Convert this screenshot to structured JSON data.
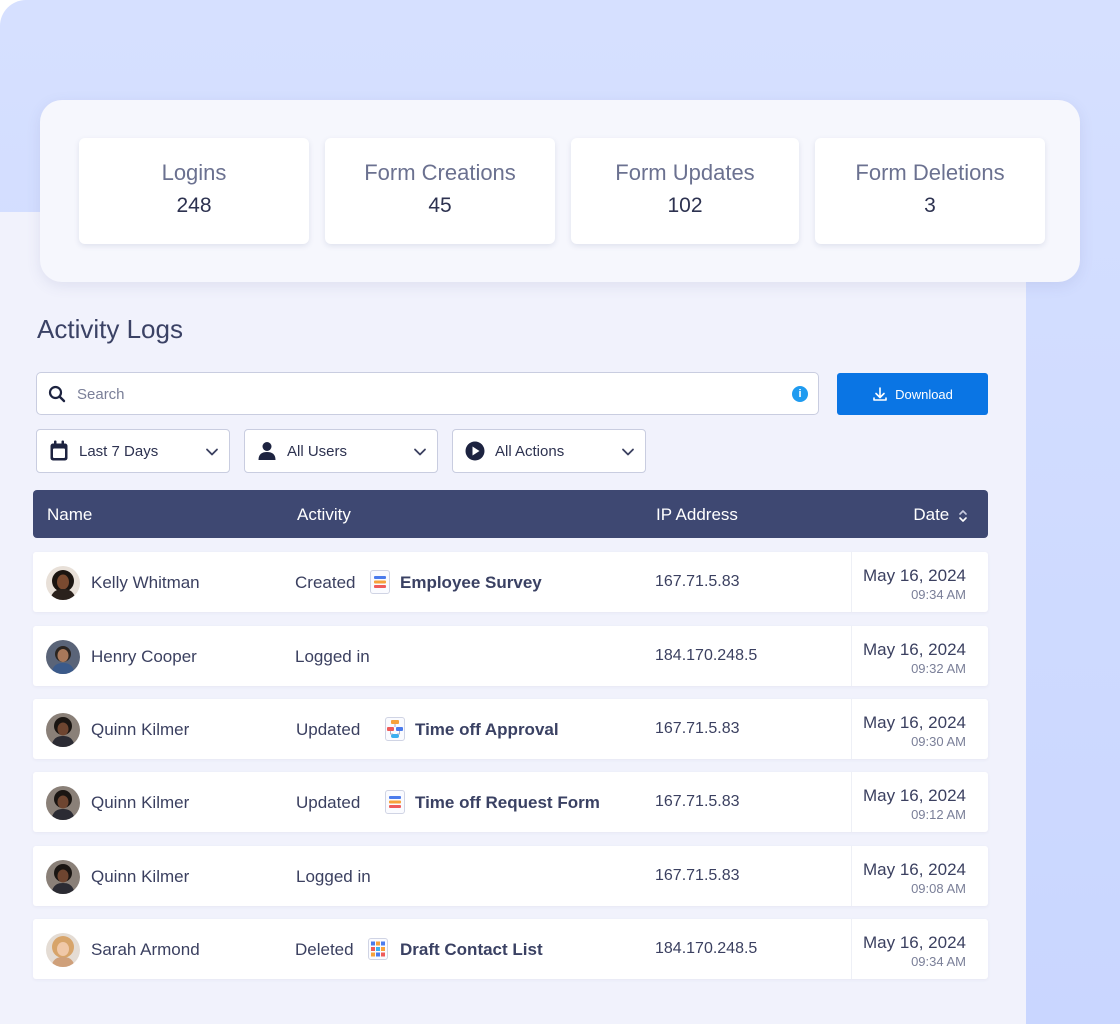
{
  "stats": [
    {
      "label": "Logins",
      "value": "248"
    },
    {
      "label": "Form Creations",
      "value": "45"
    },
    {
      "label": "Form Updates",
      "value": "102"
    },
    {
      "label": "Form Deletions",
      "value": "3"
    }
  ],
  "page_title": "Activity Logs",
  "search": {
    "placeholder": "Search",
    "value": ""
  },
  "download_label": "Download",
  "filters": {
    "date": "Last 7 Days",
    "users": "All Users",
    "actions": "All Actions"
  },
  "table": {
    "headers": {
      "name": "Name",
      "activity": "Activity",
      "ip": "IP Address",
      "date": "Date"
    },
    "rows": [
      {
        "name": "Kelly Whitman",
        "action": "Created",
        "form": "Employee Survey",
        "ip": "167.71.5.83",
        "date": "May 16, 2024",
        "time": "09:34 AM"
      },
      {
        "name": "Henry Cooper",
        "action": "Logged in",
        "form": "",
        "ip": "184.170.248.5",
        "date": "May 16, 2024",
        "time": "09:32 AM"
      },
      {
        "name": "Quinn Kilmer",
        "action": "Updated",
        "form": "Time off Approval",
        "ip": "167.71.5.83",
        "date": "May 16, 2024",
        "time": "09:30 AM"
      },
      {
        "name": "Quinn Kilmer",
        "action": "Updated",
        "form": "Time off Request Form",
        "ip": "167.71.5.83",
        "date": "May 16, 2024",
        "time": "09:12 AM"
      },
      {
        "name": "Quinn Kilmer",
        "action": "Logged in",
        "form": "",
        "ip": "167.71.5.83",
        "date": "May 16, 2024",
        "time": "09:08 AM"
      },
      {
        "name": "Sarah Armond",
        "action": "Deleted",
        "form": "Draft Contact List",
        "ip": "184.170.248.5",
        "date": "May 16, 2024",
        "time": "09:34 AM"
      }
    ]
  },
  "colors": {
    "accent": "#0a75e4",
    "table_header": "#3e4872",
    "background": "#d6e0ff"
  }
}
